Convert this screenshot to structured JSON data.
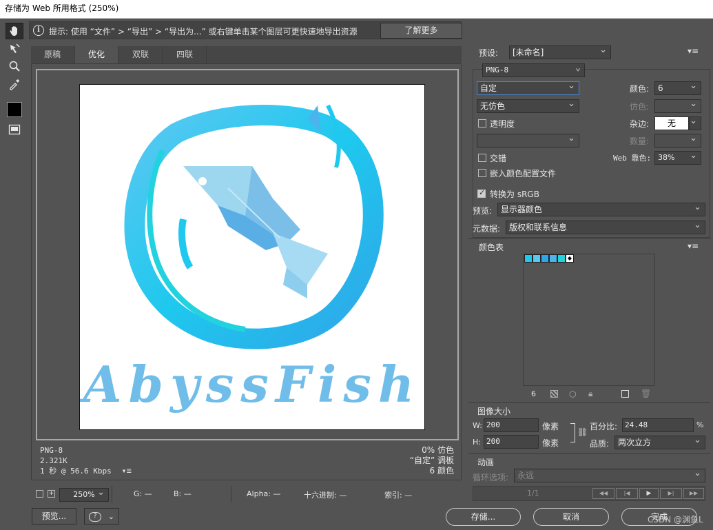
{
  "window": {
    "title": "存储为 Web 所用格式 (250%)"
  },
  "hint": {
    "text": "提示: 使用 “文件” > “导出” > “导出为...” 或右键单击某个图层可更快速地导出资源",
    "learn_more": "了解更多"
  },
  "tabs": [
    "原稿",
    "优化",
    "双联",
    "四联"
  ],
  "active_tab": "优化",
  "image_text": "AbyssFish",
  "canvas_info": {
    "format": "PNG-8",
    "size": "2.321K",
    "speed": "1 秒 @ 56.6 Kbps",
    "dither": "0% 仿色",
    "palette": "“自定” 调板",
    "colors": "6 颜色"
  },
  "status": {
    "zoom": "250%",
    "g": "G: —",
    "b": "B: —",
    "alpha": "Alpha: —",
    "hex": "十六进制: —",
    "index": "索引: —"
  },
  "bottom_buttons": {
    "preview": "预览...",
    "save": "存储...",
    "cancel": "取消",
    "done": "完成"
  },
  "watermark": "CSDN @渊鱼L",
  "settings": {
    "preset_label": "预设:",
    "preset_value": "[未命名]",
    "format": "PNG-8",
    "reduction": "自定",
    "dither_algo": "无仿色",
    "transparency": "透明度",
    "interlaced": "交错",
    "embed_profile": "嵌入颜色配置文件",
    "colors_label": "颜色:",
    "colors_value": "6",
    "dither_label": "仿色:",
    "matte_label": "杂边:",
    "matte_value": "无",
    "amount_label": "数量:",
    "web_snap_label": "Web 靠色:",
    "web_snap_value": "38%",
    "convert_srgb": "转换为 sRGB",
    "preview_label": "预览:",
    "preview_value": "显示器颜色",
    "metadata_label": "元数据:",
    "metadata_value": "版权和联系信息"
  },
  "color_table": {
    "title": "颜色表",
    "count": "6",
    "colors": [
      "#1ec8ee",
      "#5bc8f2",
      "#2fa6e8",
      "#4bb4ec",
      "#22d3df",
      "#ffffff"
    ]
  },
  "image_size": {
    "title": "图像大小",
    "w_label": "W:",
    "w_value": "200",
    "h_label": "H:",
    "h_value": "200",
    "unit": "像素",
    "percent_label": "百分比:",
    "percent_value": "24.48",
    "percent_unit": "%",
    "quality_label": "品质:",
    "quality_value": "两次立方"
  },
  "animation": {
    "title": "动画",
    "loop_label": "循环选项:",
    "loop_value": "永远",
    "frame": "1/1"
  },
  "colors": {
    "accent": "#1ec8ee",
    "panel": "#535353"
  }
}
